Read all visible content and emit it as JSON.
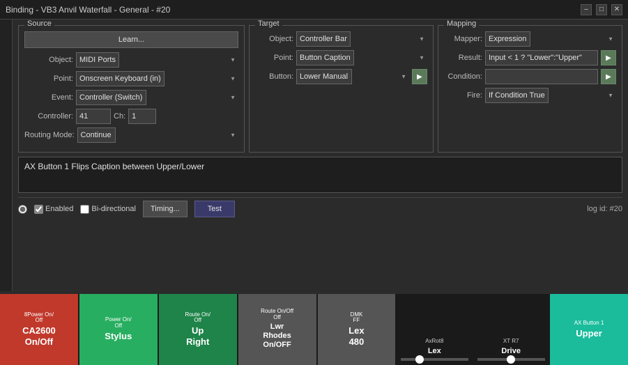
{
  "titleBar": {
    "title": "Binding - VB3 Anvil Waterfall - General - #20",
    "minimizeLabel": "–",
    "maximizeLabel": "□",
    "closeLabel": "✕"
  },
  "sourcePanel": {
    "title": "Source",
    "learnBtn": "Learn...",
    "objectLabel": "Object:",
    "objectValue": "MIDI Ports",
    "pointLabel": "Point:",
    "pointValue": "Onscreen Keyboard (in)",
    "eventLabel": "Event:",
    "eventValue": "Controller (Switch)",
    "controllerLabel": "Controller:",
    "controllerValue": "41",
    "chLabel": "Ch:",
    "chValue": "1",
    "routingModeLabel": "Routing Mode:",
    "routingModeValue": "Continue"
  },
  "targetPanel": {
    "title": "Target",
    "objectLabel": "Object:",
    "objectValue": "Controller Bar",
    "pointLabel": "Point:",
    "pointValue": "Button Caption",
    "buttonLabel": "Button:",
    "buttonValue": "Lower Manual",
    "arrowIcon": "▶"
  },
  "mappingPanel": {
    "title": "Mapping",
    "mapperLabel": "Mapper:",
    "mapperValue": "Expression",
    "resultLabel": "Result:",
    "resultValue": "Input < 1 ? \"Lower\":\"Upper\"",
    "conditionLabel": "Condition:",
    "conditionValue": "",
    "fireLabel": "Fire:",
    "fireValue": "If Condition True",
    "arrowIcon": "▶"
  },
  "description": "AX Button 1 Flips Caption between Upper/Lower",
  "bottomBar": {
    "enabledLabel": "Enabled",
    "biDirectionalLabel": "Bi-directional",
    "timingBtn": "Timing...",
    "testBtn": "Test",
    "logId": "log id: #20"
  },
  "controllerStrip": [
    {
      "id": "btn1",
      "topLabel": "8Power On/Off",
      "mainLabel": "CA2600\nOn/Off",
      "color": "red"
    },
    {
      "id": "btn2",
      "topLabel": "Power On/Off",
      "mainLabel": "Stylus",
      "color": "green"
    },
    {
      "id": "btn3",
      "topLabel": "Route On/Off",
      "mainLabel": "Up\nRight",
      "color": "darkgreen"
    },
    {
      "id": "btn4",
      "topLabel": "Route On/Off Off",
      "mainLabel": "Lwr\nRhodes\nOn/OFF",
      "color": "gray"
    },
    {
      "id": "btn5",
      "topLabel": "DMK FF",
      "mainLabel": "Lex\n480",
      "color": "gray"
    },
    {
      "id": "slider1",
      "topLabel": "AxRot8",
      "mainLabel": "Lex",
      "isSlider": true
    },
    {
      "id": "slider2",
      "topLabel": "XT R7",
      "mainLabel": "Drive",
      "isSlider": true
    },
    {
      "id": "btn6",
      "topLabel": "AX Button 1",
      "mainLabel": "Upper",
      "color": "teal"
    }
  ]
}
